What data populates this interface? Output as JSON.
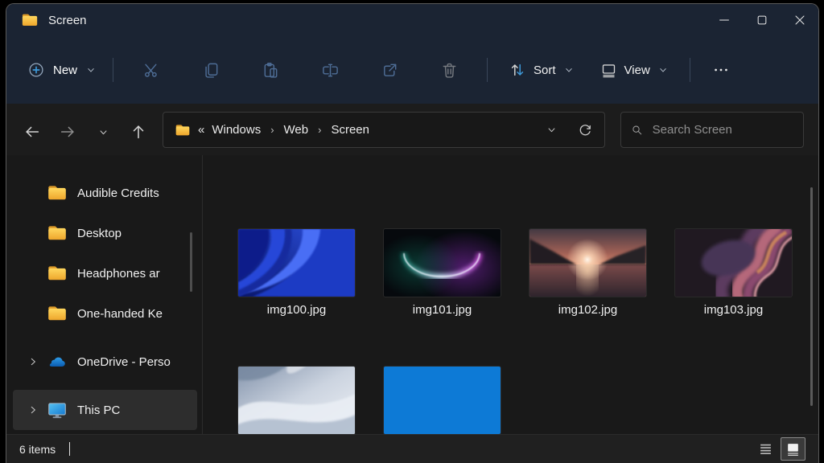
{
  "titlebar": {
    "title": "Screen"
  },
  "toolbar": {
    "new": "New",
    "sort": "Sort",
    "view": "View"
  },
  "navigation": {
    "breadcrumb": {
      "overflow": "«",
      "separator": "›",
      "items": [
        "Windows",
        "Web",
        "Screen"
      ]
    },
    "search_placeholder": "Search Screen"
  },
  "sidebar": {
    "items": [
      {
        "label": "Audible Credits",
        "icon": "folder",
        "expandable": false,
        "selected": false
      },
      {
        "label": "Desktop",
        "icon": "folder",
        "expandable": false,
        "selected": false
      },
      {
        "label": "Headphones ar",
        "icon": "folder",
        "expandable": false,
        "selected": false
      },
      {
        "label": "One-handed Ke",
        "icon": "folder",
        "expandable": false,
        "selected": false
      },
      {
        "label": "OneDrive - Perso",
        "icon": "onedrive-cloud",
        "expandable": true,
        "selected": false
      },
      {
        "label": "This PC",
        "icon": "this-pc-monitor",
        "expandable": true,
        "selected": true
      }
    ]
  },
  "files": [
    {
      "name": "img100.jpg",
      "thumbnail": "blue-bloom-abstract"
    },
    {
      "name": "img101.jpg",
      "thumbnail": "dark-glow-crescent"
    },
    {
      "name": "img102.jpg",
      "thumbnail": "sunset-over-lake"
    },
    {
      "name": "img103.jpg",
      "thumbnail": "purple-swirl-abstract"
    },
    {
      "name": "",
      "thumbnail": "light-gray-waves"
    },
    {
      "name": "",
      "thumbnail": "solid-blue"
    }
  ],
  "statusbar": {
    "item_count": "6 items"
  },
  "colors": {
    "accent_blue": "#3f9bdb",
    "titlebar_bg": "#1b2433",
    "content_bg": "#191919",
    "folder_yellow": "#f2b234",
    "solid_blue_thumbnail": "#0d7ad6"
  }
}
